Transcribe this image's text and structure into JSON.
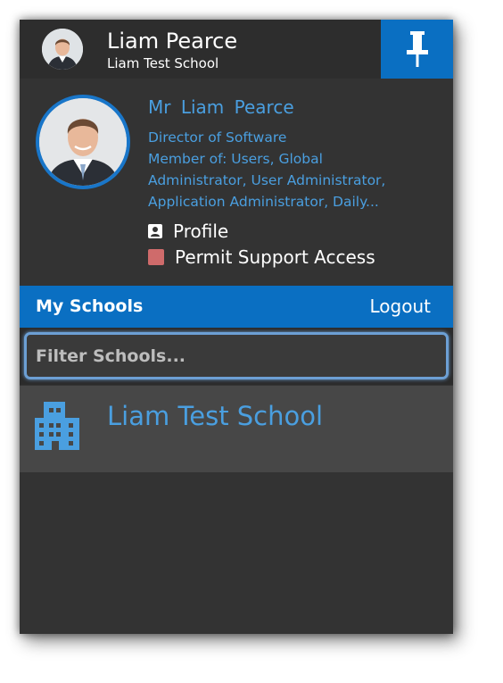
{
  "header": {
    "user_name": "Liam Pearce",
    "school_name": "Liam Test School",
    "pin_icon": "pin-icon"
  },
  "profile": {
    "full_name": "Mr  Liam  Pearce",
    "job_title": "Director of Software",
    "membership_lines": [
      "Member of: Users, Global",
      "Administrator, User Administrator,",
      "Application Administrator, Daily..."
    ],
    "profile_label": "Profile",
    "profile_icon": "contact-card-icon",
    "support_label": "Permit Support Access",
    "support_checked": false,
    "support_color": "#cf6b6b"
  },
  "schools": {
    "title": "My Schools",
    "logout_label": "Logout",
    "filter_placeholder": "Filter Schools...",
    "filter_value": "",
    "items": [
      {
        "name": "Liam Test School",
        "icon": "building-icon"
      }
    ]
  },
  "colors": {
    "accent": "#0a6fc2",
    "link": "#4a9fe0",
    "background": "#333333"
  }
}
